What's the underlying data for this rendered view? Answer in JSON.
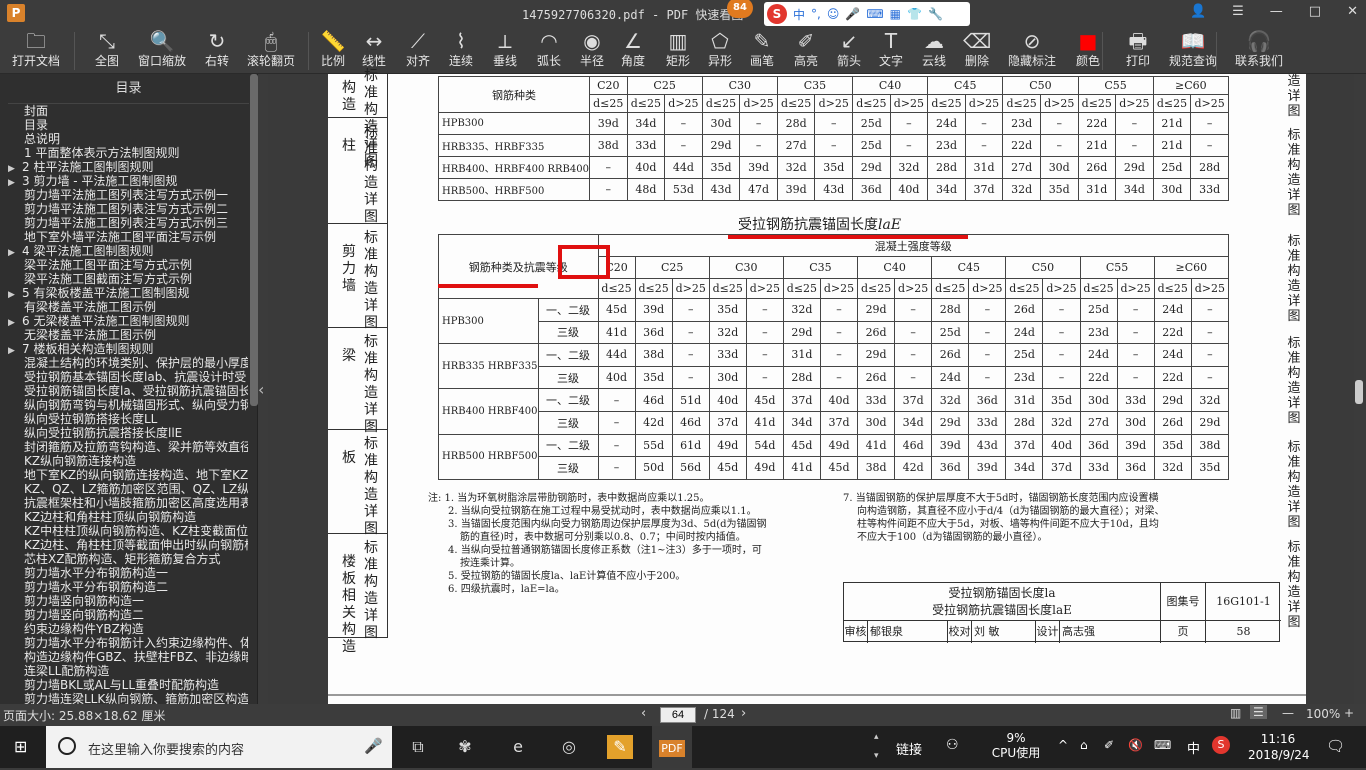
{
  "window": {
    "app_icon": "P",
    "title": "1475927706320.pdf - PDF 快速看图",
    "notification_count": "84",
    "ime": {
      "logo": "S",
      "lang": "中",
      "punct": "°,",
      "icons": [
        "emoji-icon",
        "mic-icon",
        "keyboard-icon",
        "grid-icon",
        "shirt-icon",
        "wrench-icon"
      ]
    },
    "controls": {
      "user": "👤",
      "menu": "☰",
      "minimize": "—",
      "maximize": "□",
      "close": "✕"
    }
  },
  "toolbar": [
    {
      "label": "打开文档",
      "icon": "folder-icon",
      "glyph": "🗀"
    },
    {
      "label": "全图",
      "icon": "fit-all-icon",
      "glyph": "⤡"
    },
    {
      "label": "窗口缩放",
      "icon": "zoom-icon",
      "glyph": "🔍"
    },
    {
      "label": "右转",
      "icon": "rotate-right-icon",
      "glyph": "↻"
    },
    {
      "label": "滚轮翻页",
      "icon": "mouse-icon",
      "glyph": "🖱"
    },
    {
      "label": "比例",
      "icon": "scale-icon",
      "glyph": "📏"
    },
    {
      "label": "线性",
      "icon": "linear-icon",
      "glyph": "↔"
    },
    {
      "label": "对齐",
      "icon": "align-icon",
      "glyph": "⟋"
    },
    {
      "label": "连续",
      "icon": "continuous-icon",
      "glyph": "⌇"
    },
    {
      "label": "垂线",
      "icon": "perpendicular-icon",
      "glyph": "⟂"
    },
    {
      "label": "弧长",
      "icon": "arc-length-icon",
      "glyph": "◠"
    },
    {
      "label": "半径",
      "icon": "radius-icon",
      "glyph": "◉"
    },
    {
      "label": "角度",
      "icon": "angle-icon",
      "glyph": "∠"
    },
    {
      "label": "矩形",
      "icon": "rectangle-icon",
      "glyph": "▥"
    },
    {
      "label": "异形",
      "icon": "irregular-icon",
      "glyph": "⬠"
    },
    {
      "label": "画笔",
      "icon": "pen-icon",
      "glyph": "✎"
    },
    {
      "label": "高亮",
      "icon": "highlight-icon",
      "glyph": "✐"
    },
    {
      "label": "箭头",
      "icon": "arrow-icon",
      "glyph": "↙"
    },
    {
      "label": "文字",
      "icon": "text-icon",
      "glyph": "T"
    },
    {
      "label": "云线",
      "icon": "cloud-icon",
      "glyph": "☁"
    },
    {
      "label": "删除",
      "icon": "eraser-icon",
      "glyph": "⌫"
    },
    {
      "label": "隐藏标注",
      "icon": "hide-icon",
      "glyph": "⊘"
    },
    {
      "label": "颜色",
      "icon": "color-icon",
      "glyph": "■",
      "color": "#ff0000"
    },
    {
      "label": "打印",
      "icon": "printer-icon",
      "glyph": "🖶"
    },
    {
      "label": "规范查询",
      "icon": "book-icon",
      "glyph": "📖"
    },
    {
      "label": "联系我们",
      "icon": "contact-icon",
      "glyph": "🎧"
    }
  ],
  "sidebar": {
    "header": "目录",
    "items": [
      {
        "label": "封面",
        "level": 0,
        "expandable": false
      },
      {
        "label": "目录",
        "level": 0,
        "expandable": false
      },
      {
        "label": "总说明",
        "level": 0,
        "expandable": false
      },
      {
        "label": "1 平面整体表示方法制图规则",
        "level": 0,
        "expandable": false
      },
      {
        "label": "2 柱平法施工图制图规则",
        "level": 0,
        "expandable": true
      },
      {
        "label": "3 剪力墙 - 平法施工图制图规",
        "level": 0,
        "expandable": true
      },
      {
        "label": "剪力墙平法施工图列表注写方式示例一",
        "level": 1,
        "expandable": false
      },
      {
        "label": "剪力墙平法施工图列表注写方式示例二",
        "level": 1,
        "expandable": false
      },
      {
        "label": "剪力墙平法施工图列表注写方式示例三",
        "level": 1,
        "expandable": false
      },
      {
        "label": "地下室外墙平法施工图平面注写示例",
        "level": 1,
        "expandable": false
      },
      {
        "label": "4 梁平法施工图制图规则",
        "level": 0,
        "expandable": true
      },
      {
        "label": "梁平法施工图平面注写方式示例",
        "level": 1,
        "expandable": false
      },
      {
        "label": "梁平法施工图截面注写方式示例",
        "level": 1,
        "expandable": false
      },
      {
        "label": "5 有梁板楼盖平法施工图制图规",
        "level": 0,
        "expandable": true
      },
      {
        "label": "有梁楼盖平法施工图示例",
        "level": 1,
        "expandable": false
      },
      {
        "label": "6 无梁楼盖平法施工图制图规则",
        "level": 0,
        "expandable": true
      },
      {
        "label": "无梁楼盖平法施工图示例",
        "level": 1,
        "expandable": false
      },
      {
        "label": "7 楼板相关构造制图规则",
        "level": 0,
        "expandable": true
      },
      {
        "label": "混凝土结构的环境类别、保护层的最小厚度",
        "level": 1,
        "expandable": false
      },
      {
        "label": "受拉钢筋基本锚固长度lab、抗震设计时受",
        "level": 1,
        "expandable": false
      },
      {
        "label": "受拉钢筋锚固长度la、受拉钢筋抗震锚固长",
        "level": 1,
        "expandable": false
      },
      {
        "label": "纵向钢筋弯钩与机械锚固形式、纵向受力钢",
        "level": 1,
        "expandable": false
      },
      {
        "label": "纵向受拉钢筋搭接长度LL",
        "level": 1,
        "expandable": false
      },
      {
        "label": "纵向受拉钢筋抗震搭接长度llE",
        "level": 1,
        "expandable": false
      },
      {
        "label": "封闭箍筋及拉筋弯钩构造、梁并筋等效直径",
        "level": 1,
        "expandable": false
      },
      {
        "label": "KZ纵向钢筋连接构造",
        "level": 1,
        "expandable": false
      },
      {
        "label": "地下室KZ的纵向钢筋连接构造、地下室KZ的",
        "level": 1,
        "expandable": false
      },
      {
        "label": "KZ、QZ、LZ箍筋加密区范围、QZ、LZ纵向钢",
        "level": 1,
        "expandable": false
      },
      {
        "label": "抗震框架柱和小墙肢箍筋加密区高度选用表",
        "level": 1,
        "expandable": false
      },
      {
        "label": "KZ边柱和角柱柱顶纵向钢筋构造",
        "level": 1,
        "expandable": false
      },
      {
        "label": "KZ中柱柱顶纵向钢筋构造、KZ柱变截面位置",
        "level": 1,
        "expandable": false
      },
      {
        "label": "KZ边柱、角柱柱顶等截面伸出时纵向钢筋构",
        "level": 1,
        "expandable": false
      },
      {
        "label": "芯柱XZ配筋构造、矩形箍筋复合方式",
        "level": 1,
        "expandable": false
      },
      {
        "label": "剪力墙水平分布钢筋构造一",
        "level": 1,
        "expandable": false
      },
      {
        "label": "剪力墙水平分布钢筋构造二",
        "level": 1,
        "expandable": false
      },
      {
        "label": "剪力墙竖向钢筋构造一",
        "level": 1,
        "expandable": false
      },
      {
        "label": "剪力墙竖向钢筋构造二",
        "level": 1,
        "expandable": false
      },
      {
        "label": "约束边缘构件YBZ构造",
        "level": 1,
        "expandable": false
      },
      {
        "label": "剪力墙水平分布钢筋计入约束边缘构件、体",
        "level": 1,
        "expandable": false
      },
      {
        "label": "构造边缘构件GBZ、扶壁柱FBZ、非边缘暗柱",
        "level": 1,
        "expandable": false
      },
      {
        "label": "连梁LL配筋构造",
        "level": 1,
        "expandable": false
      },
      {
        "label": "剪力墙BKL或AL与LL重叠时配筋构造",
        "level": 1,
        "expandable": false
      },
      {
        "label": "剪力墙连梁LLK纵向钢筋、箍筋加密区构造",
        "level": 1,
        "expandable": false
      }
    ]
  },
  "document": {
    "side_tabs": [
      {
        "a": "构造",
        "b": "标准构造详图"
      },
      {
        "a": "柱",
        "b": "标准构造详图"
      },
      {
        "a": "剪力墙",
        "b": "标准构造详图"
      },
      {
        "a": "梁",
        "b": "标准构造详图"
      },
      {
        "a": "板",
        "b": "标准构造详图"
      },
      {
        "a": "楼板相关构造",
        "b": "标准构造详图"
      }
    ],
    "right_tabs": [
      "造详图",
      "标准构造详图",
      "标准构造详图",
      "标准构造详图",
      "标准构造详图",
      "标准构造详图"
    ],
    "table1": {
      "header": "钢筋种类",
      "grades": [
        "C20",
        "C25",
        "C30",
        "C35",
        "C40",
        "C45",
        "C50",
        "C55",
        "≥C60"
      ],
      "sub_first": "d≤25",
      "sub": [
        "d≤25",
        "d>25"
      ],
      "rows": [
        {
          "label": "HPB300",
          "values": [
            "39d",
            "34d",
            "–",
            "30d",
            "–",
            "28d",
            "–",
            "25d",
            "–",
            "24d",
            "–",
            "23d",
            "–",
            "22d",
            "–",
            "21d",
            "–"
          ]
        },
        {
          "label": "HRB335、HRBF335",
          "values": [
            "38d",
            "33d",
            "–",
            "29d",
            "–",
            "27d",
            "–",
            "25d",
            "–",
            "23d",
            "–",
            "22d",
            "–",
            "21d",
            "–",
            "21d",
            "–"
          ]
        },
        {
          "label": "HRB400、HRBF400 RRB400",
          "values": [
            "–",
            "40d",
            "44d",
            "35d",
            "39d",
            "32d",
            "35d",
            "29d",
            "32d",
            "28d",
            "31d",
            "27d",
            "30d",
            "26d",
            "29d",
            "25d",
            "28d"
          ]
        },
        {
          "label": "HRB500、HRBF500",
          "values": [
            "–",
            "48d",
            "53d",
            "43d",
            "47d",
            "39d",
            "43d",
            "36d",
            "40d",
            "34d",
            "37d",
            "32d",
            "35d",
            "31d",
            "34d",
            "30d",
            "33d"
          ]
        }
      ]
    },
    "table2": {
      "title": "受拉钢筋抗震锚固长度",
      "title_symbol": "laE",
      "header": "钢筋种类及抗震等级",
      "group_header": "混凝土强度等级",
      "grades": [
        "C20",
        "C25",
        "C30",
        "C35",
        "C40",
        "C45",
        "C50",
        "C55",
        "≥C60"
      ],
      "sub_first": "d≤25",
      "sub": [
        "d≤25",
        "d>25"
      ],
      "rows": [
        {
          "type": "HPB300",
          "level": "一、二级",
          "values": [
            "45d",
            "39d",
            "–",
            "35d",
            "–",
            "32d",
            "–",
            "29d",
            "–",
            "28d",
            "–",
            "26d",
            "–",
            "25d",
            "–",
            "24d",
            "–"
          ]
        },
        {
          "type": "",
          "level": "三级",
          "values": [
            "41d",
            "36d",
            "–",
            "32d",
            "–",
            "29d",
            "–",
            "26d",
            "–",
            "25d",
            "–",
            "24d",
            "–",
            "23d",
            "–",
            "22d",
            "–"
          ]
        },
        {
          "type": "HRB335 HRBF335",
          "level": "一、二级",
          "values": [
            "44d",
            "38d",
            "–",
            "33d",
            "–",
            "31d",
            "–",
            "29d",
            "–",
            "26d",
            "–",
            "25d",
            "–",
            "24d",
            "–",
            "24d",
            "–"
          ]
        },
        {
          "type": "",
          "level": "三级",
          "values": [
            "40d",
            "35d",
            "–",
            "30d",
            "–",
            "28d",
            "–",
            "26d",
            "–",
            "24d",
            "–",
            "23d",
            "–",
            "22d",
            "–",
            "22d",
            "–"
          ]
        },
        {
          "type": "HRB400 HRBF400",
          "level": "一、二级",
          "values": [
            "–",
            "46d",
            "51d",
            "40d",
            "45d",
            "37d",
            "40d",
            "33d",
            "37d",
            "32d",
            "36d",
            "31d",
            "35d",
            "30d",
            "33d",
            "29d",
            "32d"
          ]
        },
        {
          "type": "",
          "level": "三级",
          "values": [
            "–",
            "42d",
            "46d",
            "37d",
            "41d",
            "34d",
            "37d",
            "30d",
            "34d",
            "29d",
            "33d",
            "28d",
            "32d",
            "27d",
            "30d",
            "26d",
            "29d"
          ]
        },
        {
          "type": "HRB500 HRBF500",
          "level": "一、二级",
          "values": [
            "–",
            "55d",
            "61d",
            "49d",
            "54d",
            "45d",
            "49d",
            "41d",
            "46d",
            "39d",
            "43d",
            "37d",
            "40d",
            "36d",
            "39d",
            "35d",
            "38d"
          ]
        },
        {
          "type": "",
          "level": "三级",
          "values": [
            "–",
            "50d",
            "56d",
            "45d",
            "49d",
            "41d",
            "45d",
            "38d",
            "42d",
            "36d",
            "39d",
            "34d",
            "37d",
            "33d",
            "36d",
            "32d",
            "35d"
          ]
        }
      ]
    },
    "notes_left": [
      "注: 1. 当为环氧树脂涂层带肋钢筋时，表中数据尚应乘以1.25。",
      "2. 当纵向受拉钢筋在施工过程中易受扰动时，表中数据尚应乘以1.1。",
      "3. 当锚固长度范围内纵向受力钢筋周边保护层厚度为3d、5d(d为锚固钢",
      "筋的直径)时，表中数据可分别乘以0.8、0.7；中间时按内插值。",
      "4. 当纵向受拉普通钢筋锚固长度修正系数（注1~注3）多于一项时，可",
      "按连乘计算。",
      "5. 受拉钢筋的锚固长度la、laE计算值不应小于200。",
      "6. 四级抗震时，laE=la。"
    ],
    "notes_right": [
      "7. 当锚固钢筋的保护层厚度不大于5d时，锚固钢筋长度范围内应设置横",
      "向构造钢筋，其直径不应小于d/4（d为锚固钢筋的最大直径）；对梁、",
      "柱等构件间距不应大于5d，对板、墙等构件间距不应大于10d，且均",
      "不应大于100（d为锚固钢筋的最小直径）。"
    ],
    "title_block": {
      "title1": "受拉钢筋锚固长度la",
      "title2": "受拉钢筋抗震锚固长度laE",
      "atlas_label": "图集号",
      "atlas_no": "16G101-1",
      "review": "审核",
      "reviewer": "郁银泉",
      "check": "校对",
      "checker": "刘 敏",
      "design": "设计",
      "designer": "高志强",
      "page_label": "页",
      "page_no": "58"
    }
  },
  "statusbar": {
    "page_size": "页面大小: 25.88×18.62 厘米",
    "current_page": "64",
    "total_pages": "/ 124",
    "zoom": "100%"
  },
  "taskbar": {
    "search_placeholder": "在这里输入你要搜索的内容",
    "link_label": "链接",
    "cpu_percent": "9%",
    "cpu_label": "CPU使用",
    "ime_lang": "中",
    "time": "11:16",
    "date": "2018/9/24"
  }
}
